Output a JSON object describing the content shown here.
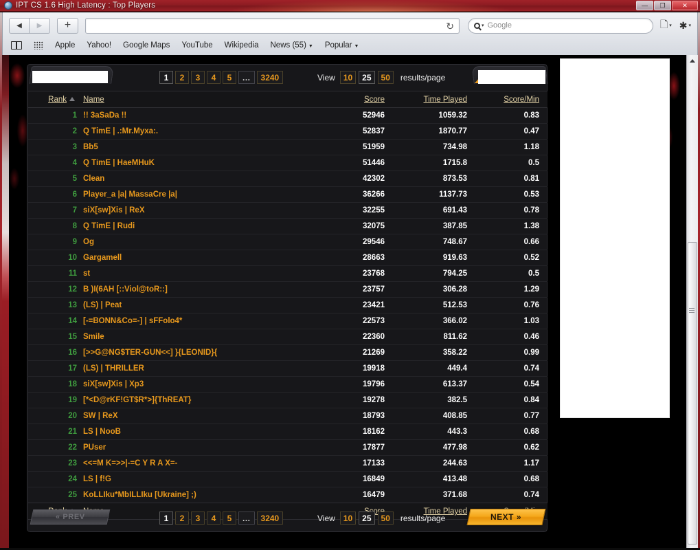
{
  "window": {
    "title": "IPT CS 1.6 High Latency : Top Players",
    "icon": "globe-icon",
    "minimize": "—",
    "maximize": "❐",
    "close": "✕"
  },
  "browser": {
    "back_icon": "◀",
    "forward_icon": "▶",
    "new_tab_icon": "+",
    "url_value": "",
    "url_placeholder": "",
    "reload_icon": "↻",
    "search_placeholder": "Google",
    "search_value": "",
    "reader_icon": "page-icon",
    "settings_icon": "gear-icon",
    "bookmarks": [
      {
        "label": "Apple",
        "caret": ""
      },
      {
        "label": "Yahoo!",
        "caret": ""
      },
      {
        "label": "Google Maps",
        "caret": ""
      },
      {
        "label": "YouTube",
        "caret": ""
      },
      {
        "label": "Wikipedia",
        "caret": ""
      },
      {
        "label": "News (55)",
        "caret": "▼"
      },
      {
        "label": "Popular",
        "caret": "▼"
      }
    ],
    "bookmarks_sidebar_icon": "book-icon",
    "top-sites_icon": "grid-icon"
  },
  "pagination_top": {
    "pages": [
      {
        "label": "1",
        "current": true
      },
      {
        "label": "2",
        "current": false
      },
      {
        "label": "3",
        "current": false
      },
      {
        "label": "4",
        "current": false
      },
      {
        "label": "5",
        "current": false
      },
      {
        "label": "...",
        "current": false
      },
      {
        "label": "3240",
        "current": false
      }
    ],
    "view_label": "View",
    "options": [
      {
        "label": "10",
        "selected": false
      },
      {
        "label": "25",
        "selected": true
      },
      {
        "label": "50",
        "selected": false
      }
    ],
    "results_label": "results/page"
  },
  "pagination_bottom": {
    "prev_label": "« PREV",
    "next_label": "NEXT »",
    "pages": [
      {
        "label": "1",
        "current": true
      },
      {
        "label": "2",
        "current": false
      },
      {
        "label": "3",
        "current": false
      },
      {
        "label": "4",
        "current": false
      },
      {
        "label": "5",
        "current": false
      },
      {
        "label": "...",
        "current": false
      },
      {
        "label": "3240",
        "current": false
      }
    ],
    "view_label": "View",
    "options": [
      {
        "label": "10",
        "selected": false
      },
      {
        "label": "25",
        "selected": true
      },
      {
        "label": "50",
        "selected": false
      }
    ],
    "results_label": "results/page"
  },
  "table": {
    "columns": {
      "rank": "Rank",
      "name": "Name",
      "score": "Score",
      "time_played": "Time Played",
      "score_min": "Score/Min"
    },
    "sort_column": "Rank",
    "sort_direction": "asc",
    "rows": [
      {
        "rank": "1",
        "name": "!! 3aSaDa !!",
        "score": "52946",
        "time": "1059.32",
        "spm": "0.83"
      },
      {
        "rank": "2",
        "name": "Q TimE | .:Mr.Myxa:.",
        "score": "52837",
        "time": "1870.77",
        "spm": "0.47"
      },
      {
        "rank": "3",
        "name": "Bb5",
        "score": "51959",
        "time": "734.98",
        "spm": "1.18"
      },
      {
        "rank": "4",
        "name": "Q TimE | HaeMHuK",
        "score": "51446",
        "time": "1715.8",
        "spm": "0.5"
      },
      {
        "rank": "5",
        "name": "Clean",
        "score": "42302",
        "time": "873.53",
        "spm": "0.81"
      },
      {
        "rank": "6",
        "name": "Player_a |a| MassaCre |a|",
        "score": "36266",
        "time": "1137.73",
        "spm": "0.53"
      },
      {
        "rank": "7",
        "name": "siX[sw]Xis | ReX",
        "score": "32255",
        "time": "691.43",
        "spm": "0.78"
      },
      {
        "rank": "8",
        "name": "Q TimE | Rudi",
        "score": "32075",
        "time": "387.85",
        "spm": "1.38"
      },
      {
        "rank": "9",
        "name": "Og",
        "score": "29546",
        "time": "748.67",
        "spm": "0.66"
      },
      {
        "rank": "10",
        "name": "Gargamell",
        "score": "28663",
        "time": "919.63",
        "spm": "0.52"
      },
      {
        "rank": "11",
        "name": "st",
        "score": "23768",
        "time": "794.25",
        "spm": "0.5"
      },
      {
        "rank": "12",
        "name": "B )I(6AH [::Viol@toR::]",
        "score": "23757",
        "time": "306.28",
        "spm": "1.29"
      },
      {
        "rank": "13",
        "name": "(LS) | Peat",
        "score": "23421",
        "time": "512.53",
        "spm": "0.76"
      },
      {
        "rank": "14",
        "name": "[-=BONN&Co=-] | sFFolo4*",
        "score": "22573",
        "time": "366.02",
        "spm": "1.03"
      },
      {
        "rank": "15",
        "name": "Smile",
        "score": "22360",
        "time": "811.62",
        "spm": "0.46"
      },
      {
        "rank": "16",
        "name": "[>>G@NG$TER-GUN<<] }{LEONID}{",
        "score": "21269",
        "time": "358.22",
        "spm": "0.99"
      },
      {
        "rank": "17",
        "name": "(LS) | THRILLER",
        "score": "19918",
        "time": "449.4",
        "spm": "0.74"
      },
      {
        "rank": "18",
        "name": "siX[sw]Xis | Xp3",
        "score": "19796",
        "time": "613.37",
        "spm": "0.54"
      },
      {
        "rank": "19",
        "name": "[*<D@rKF!GT$R*>]{ThREAT}",
        "score": "19278",
        "time": "382.5",
        "spm": "0.84"
      },
      {
        "rank": "20",
        "name": "SW | ReX",
        "score": "18793",
        "time": "408.85",
        "spm": "0.77"
      },
      {
        "rank": "21",
        "name": "LS | NooB",
        "score": "18162",
        "time": "443.3",
        "spm": "0.68"
      },
      {
        "rank": "22",
        "name": "PUser",
        "score": "17877",
        "time": "477.98",
        "spm": "0.62"
      },
      {
        "rank": "23",
        "name": "<<=M K=>>|-=C Y R A X=-",
        "score": "17133",
        "time": "244.63",
        "spm": "1.17"
      },
      {
        "rank": "24",
        "name": "LS | f!G",
        "score": "16849",
        "time": "413.48",
        "spm": "0.68"
      },
      {
        "rank": "25",
        "name": "KoLLIku*MbILLIku [Ukraine] ;)",
        "score": "16479",
        "time": "371.68",
        "spm": "0.74"
      }
    ]
  },
  "colors": {
    "accent_orange": "#e8991d",
    "rank_green": "#3f9c3f",
    "header_tan": "#e3d2a6",
    "panel_bg": "#17171a",
    "title_red": "#8d1c22"
  }
}
